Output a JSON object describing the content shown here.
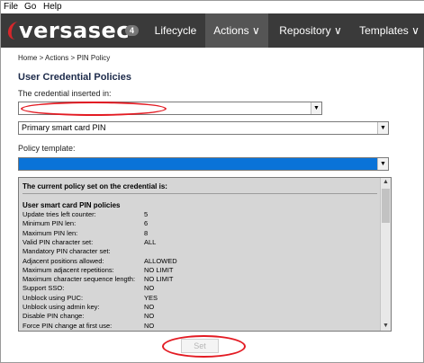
{
  "menu": [
    "File",
    "Go",
    "Help"
  ],
  "app": {
    "logo": "versasec",
    "badge": "4",
    "nav": [
      {
        "label": "Lifecycle",
        "active": false
      },
      {
        "label": "Actions ∨",
        "active": true
      },
      {
        "label": "Repository ∨",
        "active": false
      },
      {
        "label": "Templates ∨",
        "active": false
      }
    ]
  },
  "breadcrumb": "Home > Actions > PIN Policy",
  "page_title": "User Credential Policies",
  "credential": {
    "label": "The credential inserted in:",
    "value": ""
  },
  "pin_type": {
    "value": "Primary smart card PIN"
  },
  "policy_template": {
    "label": "Policy template:",
    "value": ""
  },
  "policy": {
    "heading": "The current policy set on the credential is:",
    "section": "User smart card PIN policies",
    "rows": [
      {
        "k": "Update tries left counter:",
        "v": "5"
      },
      {
        "k": "Minimum PIN len:",
        "v": "6"
      },
      {
        "k": "Maximum PIN len:",
        "v": "8"
      },
      {
        "k": "Valid PIN character set:",
        "v": "ALL"
      },
      {
        "k": "Mandatory PIN character set:",
        "v": ""
      },
      {
        "k": "Adjacent positions allowed:",
        "v": "ALLOWED"
      },
      {
        "k": "Maximum adjacent repetitions:",
        "v": "NO LIMIT"
      },
      {
        "k": "Maximum character sequence length:",
        "v": "NO LIMIT"
      },
      {
        "k": "Support SSO:",
        "v": "NO"
      },
      {
        "k": "Unblock using PUC:",
        "v": "YES"
      },
      {
        "k": "Unblock using admin key:",
        "v": "NO"
      },
      {
        "k": "Disable PIN change:",
        "v": "NO"
      },
      {
        "k": "Force PIN change at first use:",
        "v": "NO"
      }
    ]
  },
  "set_button": "Set",
  "colors": {
    "accent_red": "#e31b23",
    "selection_blue": "#0a73d8",
    "appbar": "#3a3a3a"
  }
}
